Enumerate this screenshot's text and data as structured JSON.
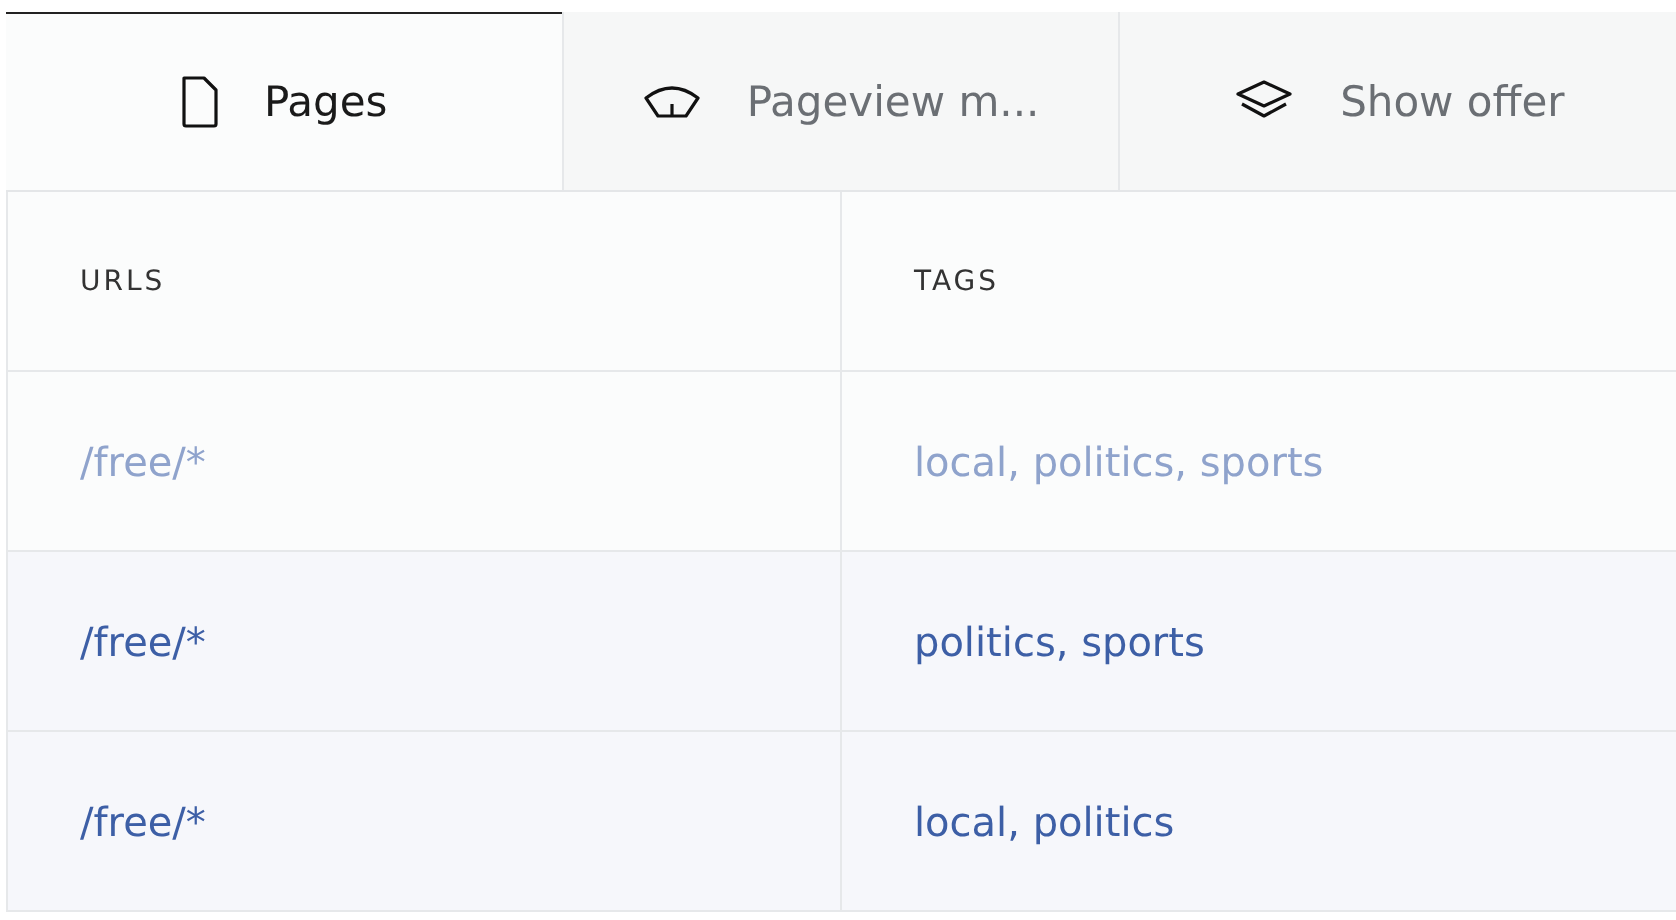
{
  "tabs": [
    {
      "label": "Pages",
      "kind": "page",
      "selected": true
    },
    {
      "label": "Pageview m...",
      "kind": "gauge",
      "selected": false
    },
    {
      "label": "Show offer",
      "kind": "layers",
      "selected": false
    }
  ],
  "table": {
    "columns": [
      "URLS",
      "TAGS"
    ],
    "rows": [
      {
        "cells": [
          "/free/*",
          "local, politics, sports"
        ],
        "dimmed": true
      },
      {
        "cells": [
          "/free/*",
          "politics, sports"
        ],
        "dimmed": false
      },
      {
        "cells": [
          "/free/*",
          "local, politics"
        ],
        "dimmed": false
      }
    ]
  }
}
